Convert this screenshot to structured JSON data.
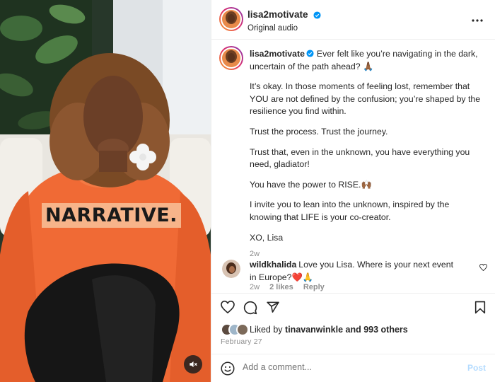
{
  "post": {
    "author": "lisa2motivate",
    "audio_label": "Original audio",
    "sticker_text": "NARRATIVE.",
    "caption_paragraphs": [
      "Ever felt like you’re navigating in the dark, uncertain of the path ahead? 🙏🏾",
      "It’s okay. In those moments of feeling lost, remember that YOU are not defined by the confusion; you’re shaped by the resilience you find within.",
      "Trust the process. Trust the journey.",
      "Trust that, even in the unknown, you have everything you need, gladiator!",
      "You have the power to RISE.🙌🏾",
      "I invite you to lean into the unknown, inspired by the knowing that LIFE is your co-creator.",
      "XO, Lisa"
    ],
    "caption_time": "2w",
    "date": "February 27"
  },
  "comment": {
    "author": "wildkhalida",
    "text": "Love you Lisa. Where is your next event in Europe?❤️🙏",
    "time": "2w",
    "likes": "2 likes",
    "reply_label": "Reply"
  },
  "likes": {
    "prefix": "Liked by",
    "user": "tinavanwinkle",
    "suffix": "and 993 others"
  },
  "composer": {
    "placeholder": "Add a comment...",
    "post_label": "Post"
  },
  "colors": {
    "verified": "#0095f6",
    "sticker_bg": "#f7b48a",
    "shirt": "#f06a35",
    "post_disabled": "#b3dbff"
  },
  "icons": [
    "more-icon",
    "heart-icon",
    "comment-icon",
    "share-icon",
    "bookmark-icon",
    "emoji-icon",
    "mute-icon",
    "verified-icon"
  ]
}
